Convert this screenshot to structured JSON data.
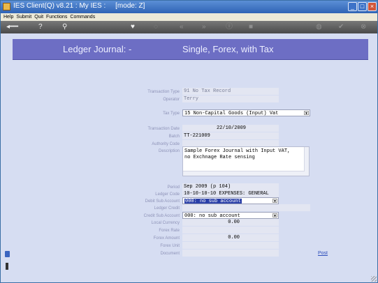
{
  "window": {
    "title": "IES Client(Q) v8.21 : My IES :     [mode: Z]",
    "controls": [
      "_",
      "□",
      "×"
    ]
  },
  "menu": [
    "Help",
    "Submit",
    "Quit",
    "Functions",
    "Commands"
  ],
  "toolbar": {
    "icons": [
      "back-arrow-icon",
      "help-icon",
      "search-icon",
      "heart-icon",
      "bookmark-icon",
      "rewind-icon",
      "forward-icon",
      "info-icon",
      "stop-icon",
      "globe-icon",
      "check-icon",
      "close-icon"
    ],
    "glyphs": {
      "back": "◂━━",
      "help": "?",
      "search": "⚲",
      "heart": "♥",
      "bookmark": "◌",
      "rewind": "«",
      "forward": "»",
      "info": "ⓘ",
      "stop": "■",
      "globe": "◍",
      "check": "✔",
      "close": "⊗"
    }
  },
  "banner": {
    "left": "Ledger Journal: -",
    "right": "Single, Forex, with Tax"
  },
  "form": {
    "transaction_type": {
      "label": "Transaction Type",
      "value": "91 No Tax Record"
    },
    "operator": {
      "label": "Operator",
      "value": "Terry"
    },
    "tax_type": {
      "label": "Tax Type",
      "value": "15 Non-Capital Goods (Input) Vat"
    },
    "transaction_date": {
      "label": "Transaction Date",
      "value": "22/10/2009"
    },
    "batch": {
      "label": "Batch",
      "value": "TT-221009"
    },
    "authority_code": {
      "label": "Authority Code",
      "value": ""
    },
    "description": {
      "label": "Description",
      "lines": [
        "Sample Forex Journal with Input VAT,",
        "no Exchnage Rate sensing"
      ]
    },
    "period": {
      "label": "Period",
      "value": "Sep 2009 (p 104)"
    },
    "ledger_code": {
      "label": "Ledger Code",
      "value": "10-10-10-10 EXPENSES: GENERAL"
    },
    "debit_sub_account": {
      "label": "Debit Sub Account",
      "value": "000: no sub account"
    },
    "ledger_credit": {
      "label": "Ledger Credit",
      "value": ""
    },
    "credit_sub_account": {
      "label": "Credit Sub Account",
      "value": "000: no sub account"
    },
    "local_currency": {
      "label": "Local Currency",
      "value": "0.00"
    },
    "forex_rate": {
      "label": "Forex Rate",
      "value": ""
    },
    "forex_amount": {
      "label": "Forex Amount",
      "value": "0.00"
    },
    "forex_unit": {
      "label": "Forex Unit",
      "value": ""
    },
    "document": {
      "label": "Document",
      "value": ""
    }
  },
  "actions": {
    "post": "Post"
  },
  "dropdown_glyph": "▼"
}
